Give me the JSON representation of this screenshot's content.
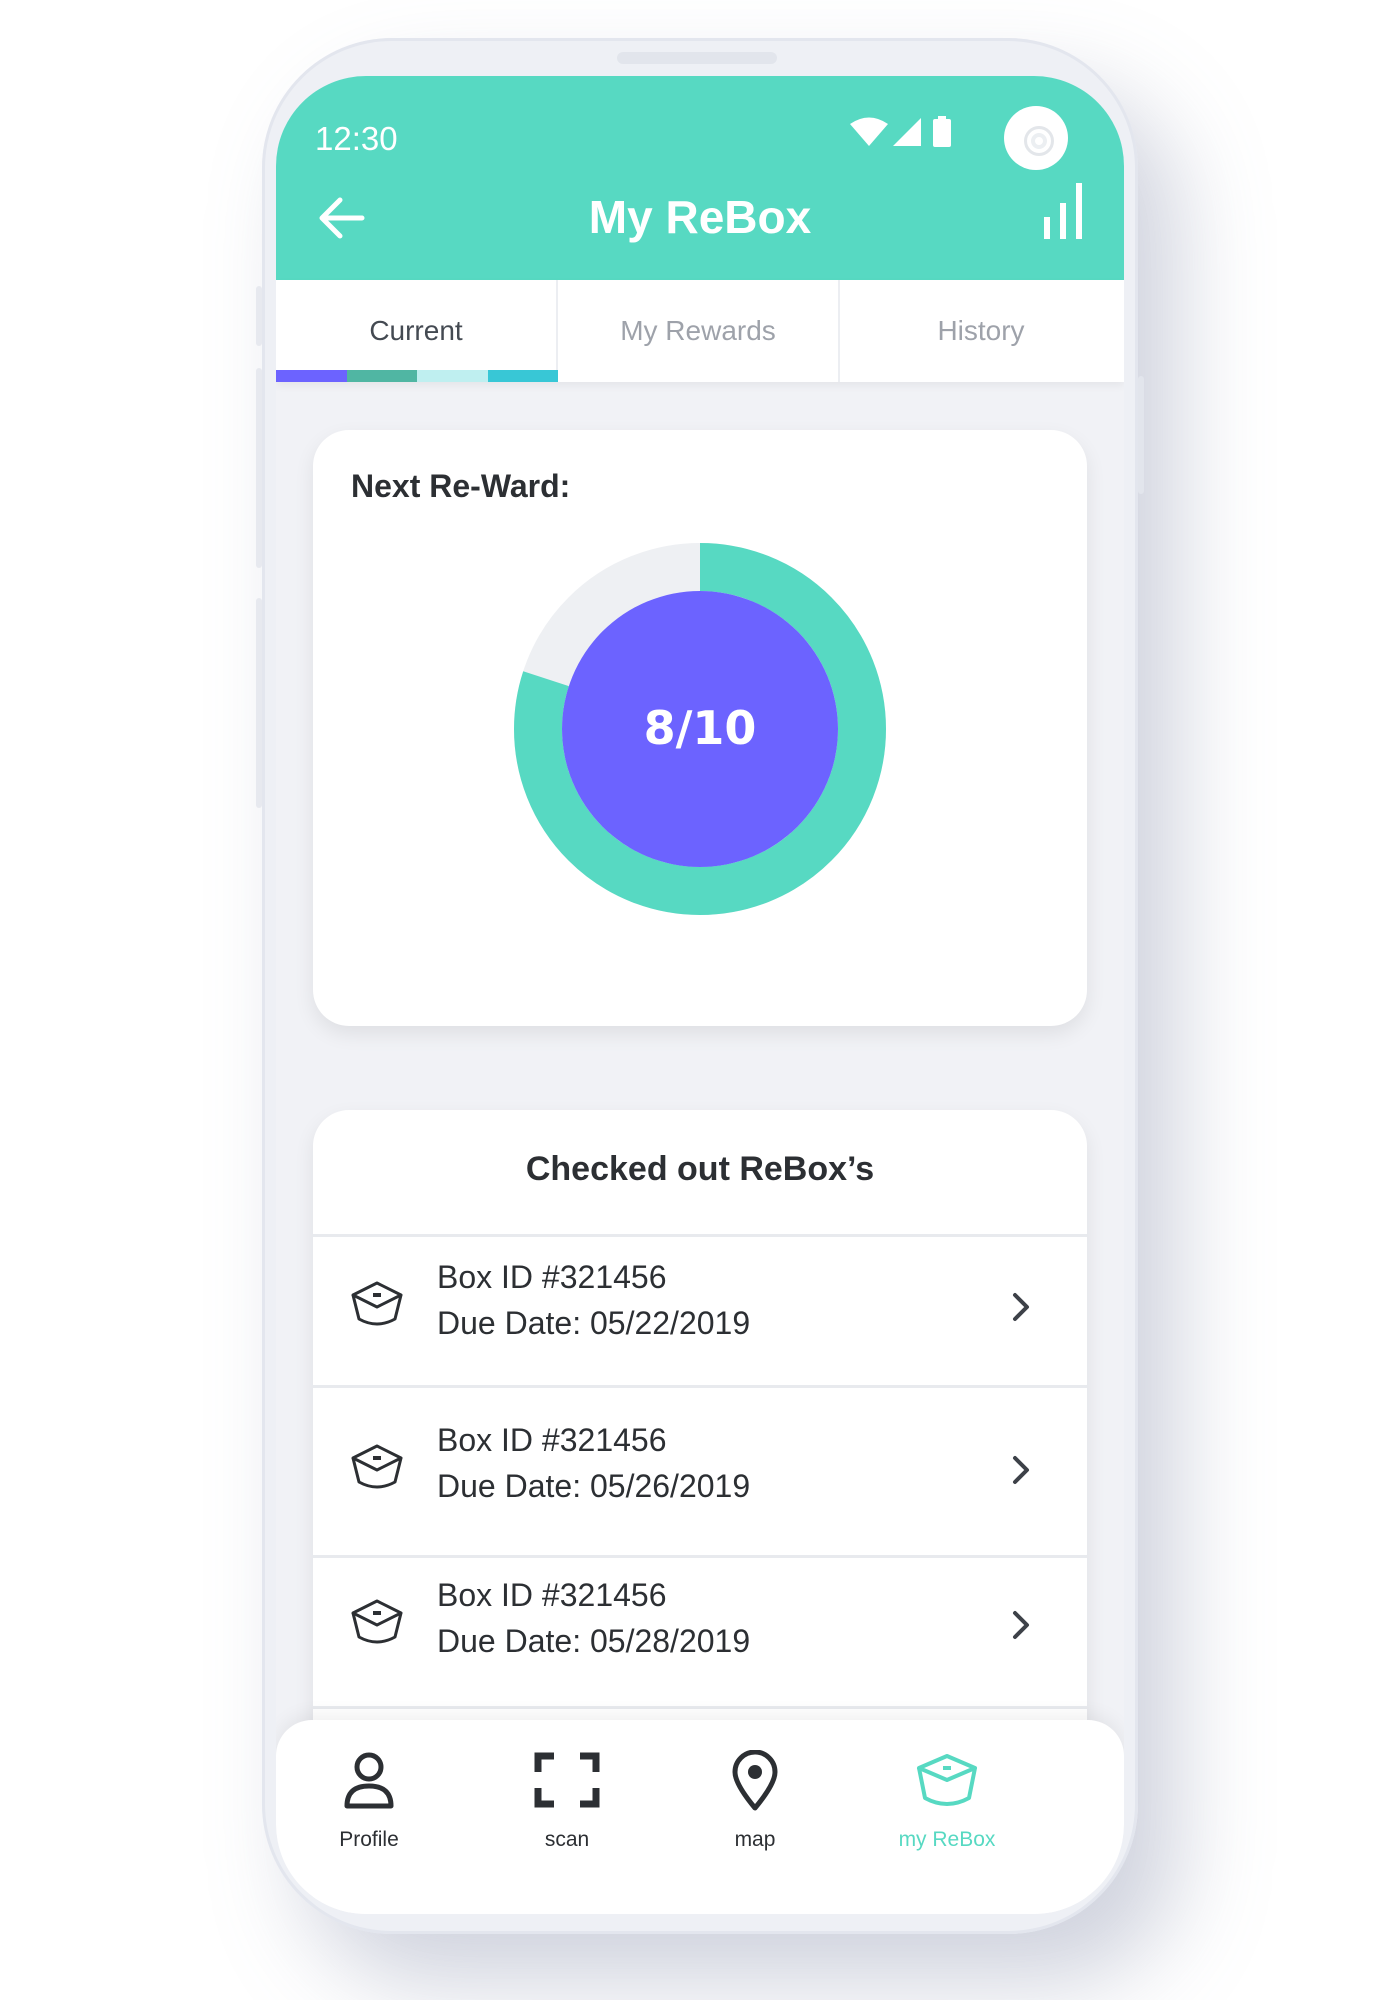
{
  "colors": {
    "accent": "#57d9c2",
    "progress_inner": "#6c63ff",
    "progress_track": "#eef0f3",
    "tab_indicator": [
      "#6c63ff",
      "#50b6a3",
      "#bfeff0",
      "#38c7d6"
    ]
  },
  "status_bar": {
    "time": "12:30",
    "icons": [
      "wifi-icon",
      "cell-signal-icon",
      "battery-icon"
    ]
  },
  "app_bar": {
    "title": "My ReBox",
    "left_icon": "arrow-left-icon",
    "right_icon": "bar-chart-icon"
  },
  "tabs": [
    {
      "label": "Current",
      "active": true
    },
    {
      "label": "My Rewards",
      "active": false
    },
    {
      "label": "History",
      "active": false
    }
  ],
  "reward": {
    "title": "Next Re-Ward:",
    "progress_text": "8/10",
    "progress_value": 8,
    "progress_total": 10
  },
  "checked_out": {
    "title": "Checked out ReBox’s",
    "items": [
      {
        "box_id": "Box ID #321456",
        "due_date": "Due Date: 05/22/2019",
        "icon": "box-icon"
      },
      {
        "box_id": "Box ID #321456",
        "due_date": "Due Date: 05/26/2019",
        "icon": "box-icon"
      },
      {
        "box_id": "Box ID #321456",
        "due_date": "Due Date: 05/28/2019",
        "icon": "box-icon"
      }
    ]
  },
  "bottom_nav": [
    {
      "label": "Profile",
      "icon": "person-icon",
      "active": false
    },
    {
      "label": "scan",
      "icon": "scan-frame-icon",
      "active": false
    },
    {
      "label": "map",
      "icon": "map-pin-icon",
      "active": false
    },
    {
      "label": "my ReBox",
      "icon": "box-icon",
      "active": true
    }
  ]
}
